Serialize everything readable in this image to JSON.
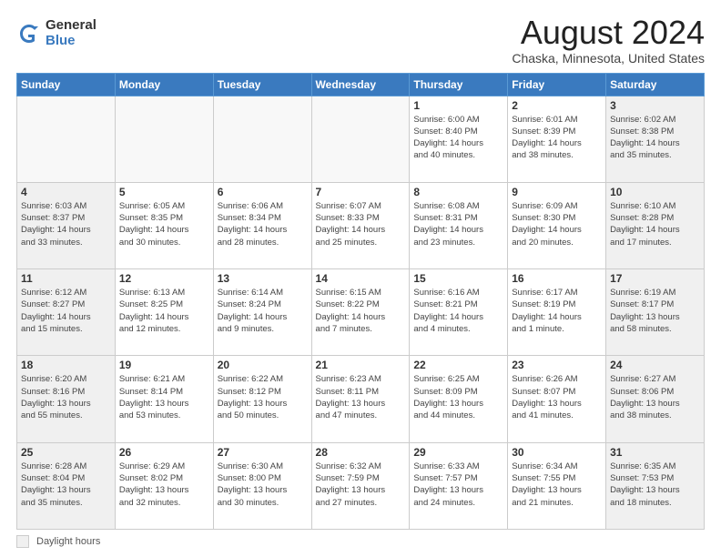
{
  "header": {
    "logo": {
      "general": "General",
      "blue": "Blue"
    },
    "title": "August 2024",
    "subtitle": "Chaska, Minnesota, United States"
  },
  "calendar": {
    "days_of_week": [
      "Sunday",
      "Monday",
      "Tuesday",
      "Wednesday",
      "Thursday",
      "Friday",
      "Saturday"
    ],
    "weeks": [
      [
        {
          "day": "",
          "info": ""
        },
        {
          "day": "",
          "info": ""
        },
        {
          "day": "",
          "info": ""
        },
        {
          "day": "",
          "info": ""
        },
        {
          "day": "1",
          "info": "Sunrise: 6:00 AM\nSunset: 8:40 PM\nDaylight: 14 hours\nand 40 minutes."
        },
        {
          "day": "2",
          "info": "Sunrise: 6:01 AM\nSunset: 8:39 PM\nDaylight: 14 hours\nand 38 minutes."
        },
        {
          "day": "3",
          "info": "Sunrise: 6:02 AM\nSunset: 8:38 PM\nDaylight: 14 hours\nand 35 minutes."
        }
      ],
      [
        {
          "day": "4",
          "info": "Sunrise: 6:03 AM\nSunset: 8:37 PM\nDaylight: 14 hours\nand 33 minutes."
        },
        {
          "day": "5",
          "info": "Sunrise: 6:05 AM\nSunset: 8:35 PM\nDaylight: 14 hours\nand 30 minutes."
        },
        {
          "day": "6",
          "info": "Sunrise: 6:06 AM\nSunset: 8:34 PM\nDaylight: 14 hours\nand 28 minutes."
        },
        {
          "day": "7",
          "info": "Sunrise: 6:07 AM\nSunset: 8:33 PM\nDaylight: 14 hours\nand 25 minutes."
        },
        {
          "day": "8",
          "info": "Sunrise: 6:08 AM\nSunset: 8:31 PM\nDaylight: 14 hours\nand 23 minutes."
        },
        {
          "day": "9",
          "info": "Sunrise: 6:09 AM\nSunset: 8:30 PM\nDaylight: 14 hours\nand 20 minutes."
        },
        {
          "day": "10",
          "info": "Sunrise: 6:10 AM\nSunset: 8:28 PM\nDaylight: 14 hours\nand 17 minutes."
        }
      ],
      [
        {
          "day": "11",
          "info": "Sunrise: 6:12 AM\nSunset: 8:27 PM\nDaylight: 14 hours\nand 15 minutes."
        },
        {
          "day": "12",
          "info": "Sunrise: 6:13 AM\nSunset: 8:25 PM\nDaylight: 14 hours\nand 12 minutes."
        },
        {
          "day": "13",
          "info": "Sunrise: 6:14 AM\nSunset: 8:24 PM\nDaylight: 14 hours\nand 9 minutes."
        },
        {
          "day": "14",
          "info": "Sunrise: 6:15 AM\nSunset: 8:22 PM\nDaylight: 14 hours\nand 7 minutes."
        },
        {
          "day": "15",
          "info": "Sunrise: 6:16 AM\nSunset: 8:21 PM\nDaylight: 14 hours\nand 4 minutes."
        },
        {
          "day": "16",
          "info": "Sunrise: 6:17 AM\nSunset: 8:19 PM\nDaylight: 14 hours\nand 1 minute."
        },
        {
          "day": "17",
          "info": "Sunrise: 6:19 AM\nSunset: 8:17 PM\nDaylight: 13 hours\nand 58 minutes."
        }
      ],
      [
        {
          "day": "18",
          "info": "Sunrise: 6:20 AM\nSunset: 8:16 PM\nDaylight: 13 hours\nand 55 minutes."
        },
        {
          "day": "19",
          "info": "Sunrise: 6:21 AM\nSunset: 8:14 PM\nDaylight: 13 hours\nand 53 minutes."
        },
        {
          "day": "20",
          "info": "Sunrise: 6:22 AM\nSunset: 8:12 PM\nDaylight: 13 hours\nand 50 minutes."
        },
        {
          "day": "21",
          "info": "Sunrise: 6:23 AM\nSunset: 8:11 PM\nDaylight: 13 hours\nand 47 minutes."
        },
        {
          "day": "22",
          "info": "Sunrise: 6:25 AM\nSunset: 8:09 PM\nDaylight: 13 hours\nand 44 minutes."
        },
        {
          "day": "23",
          "info": "Sunrise: 6:26 AM\nSunset: 8:07 PM\nDaylight: 13 hours\nand 41 minutes."
        },
        {
          "day": "24",
          "info": "Sunrise: 6:27 AM\nSunset: 8:06 PM\nDaylight: 13 hours\nand 38 minutes."
        }
      ],
      [
        {
          "day": "25",
          "info": "Sunrise: 6:28 AM\nSunset: 8:04 PM\nDaylight: 13 hours\nand 35 minutes."
        },
        {
          "day": "26",
          "info": "Sunrise: 6:29 AM\nSunset: 8:02 PM\nDaylight: 13 hours\nand 32 minutes."
        },
        {
          "day": "27",
          "info": "Sunrise: 6:30 AM\nSunset: 8:00 PM\nDaylight: 13 hours\nand 30 minutes."
        },
        {
          "day": "28",
          "info": "Sunrise: 6:32 AM\nSunset: 7:59 PM\nDaylight: 13 hours\nand 27 minutes."
        },
        {
          "day": "29",
          "info": "Sunrise: 6:33 AM\nSunset: 7:57 PM\nDaylight: 13 hours\nand 24 minutes."
        },
        {
          "day": "30",
          "info": "Sunrise: 6:34 AM\nSunset: 7:55 PM\nDaylight: 13 hours\nand 21 minutes."
        },
        {
          "day": "31",
          "info": "Sunrise: 6:35 AM\nSunset: 7:53 PM\nDaylight: 13 hours\nand 18 minutes."
        }
      ]
    ]
  },
  "footer": {
    "legend_label": "Daylight hours"
  }
}
